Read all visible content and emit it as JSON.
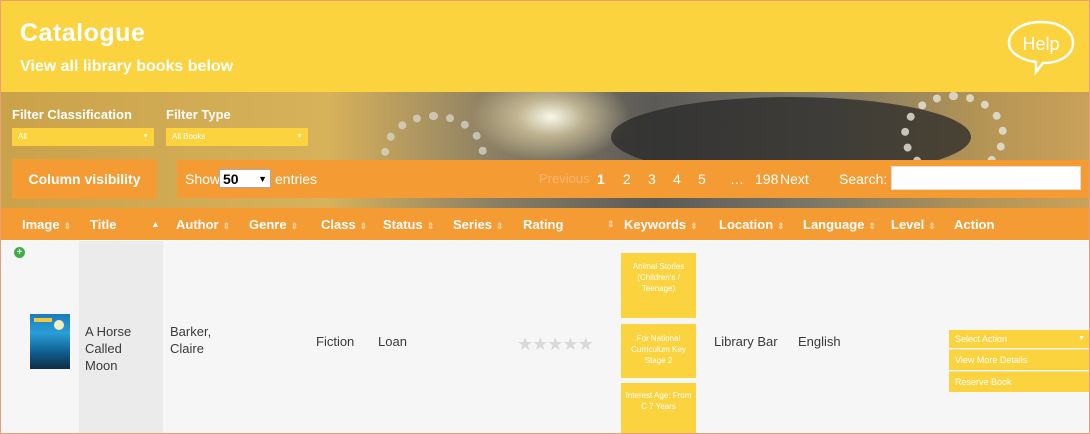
{
  "header": {
    "title": "Catalogue",
    "subtitle": "View all library books below",
    "help_label": "Help"
  },
  "filters": {
    "classification_label": "Filter Classification",
    "classification_value": "All",
    "type_label": "Filter Type",
    "type_value": "All Books"
  },
  "toolbar": {
    "column_visibility_label": "Column visibility",
    "show_label": "Show",
    "entries_value": "50",
    "entries_label": "entries",
    "pagination": {
      "previous": "Previous",
      "pages": [
        "1",
        "2",
        "3",
        "4",
        "5"
      ],
      "current": "1",
      "ellipsis": "…",
      "last": "198",
      "next": "Next"
    },
    "search_label": "Search:",
    "search_value": ""
  },
  "table": {
    "columns": [
      "Image",
      "Title",
      "Author",
      "Genre",
      "Class",
      "Status",
      "Series",
      "Rating",
      "Keywords",
      "Location",
      "Language",
      "Level",
      "Action"
    ],
    "rows": [
      {
        "title": "A Horse Called Moon",
        "author": "Barker, Claire",
        "genre": "",
        "class": "Fiction",
        "status": "Loan",
        "series": "",
        "rating": 0,
        "rating_max": 5,
        "keywords": [
          "Animal Stories (Children's / Teenage)",
          "For National Curriculum Key Stage 2",
          "Interest Age: From C 7 Years"
        ],
        "location": "Library Bar",
        "language": "English",
        "level": "",
        "action_select": "Select Action",
        "action_options": [
          "View More Details",
          "Reserve Book"
        ]
      }
    ]
  },
  "colors": {
    "header_yellow": "#fbd33f",
    "toolbar_orange": "#f49b33",
    "row_bg": "#f6f6f6"
  }
}
